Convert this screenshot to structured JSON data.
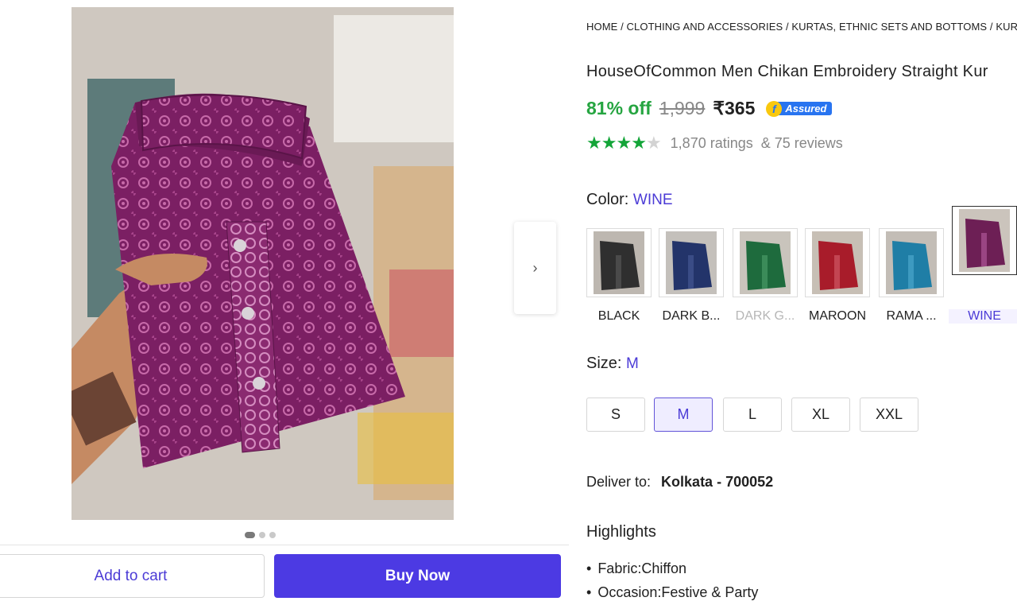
{
  "breadcrumb": "HOME / CLOTHING AND ACCESSORIES / KURTAS, ETHNIC SETS AND BOTTOMS / KUR",
  "product": {
    "title": "HouseOfCommon Men Chikan Embroidery Straight Kur",
    "discount": "81% off",
    "mrp": "1,999",
    "price": "₹365",
    "assured_label": "Assured",
    "rating_value": 4,
    "ratings_text": "1,870 ratings",
    "reviews_text": "& 75 reviews"
  },
  "color": {
    "label": "Color:",
    "selected": "WINE",
    "options": [
      {
        "name": "BLACK",
        "hex": "#2f2f2f",
        "available": true
      },
      {
        "name": "DARK B...",
        "hex": "#23346a",
        "available": true
      },
      {
        "name": "DARK G...",
        "hex": "#1e6b3d",
        "available": false
      },
      {
        "name": "MAROON",
        "hex": "#a81c2a",
        "available": true
      },
      {
        "name": "RAMA ...",
        "hex": "#1f7ea6",
        "available": true
      },
      {
        "name": "WINE",
        "hex": "#6d1f55",
        "available": true
      }
    ]
  },
  "size": {
    "label": "Size:",
    "selected": "M",
    "options": [
      "S",
      "M",
      "L",
      "XL",
      "XXL"
    ]
  },
  "delivery": {
    "label": "Deliver to:",
    "location": "Kolkata - 700052"
  },
  "highlights": {
    "title": "Highlights",
    "items": [
      "Fabric:Chiffon",
      "Occasion:Festive & Party"
    ]
  },
  "actions": {
    "add_to_cart": "Add to cart",
    "buy_now": "Buy Now"
  },
  "carousel": {
    "current": 1,
    "total": 3
  },
  "icons": {
    "next": "chevron-right-icon",
    "assured": "flipkart-assured-icon"
  },
  "colors": {
    "accent": "#4c3ae3",
    "discount": "#26a541",
    "star": "#13a538"
  }
}
